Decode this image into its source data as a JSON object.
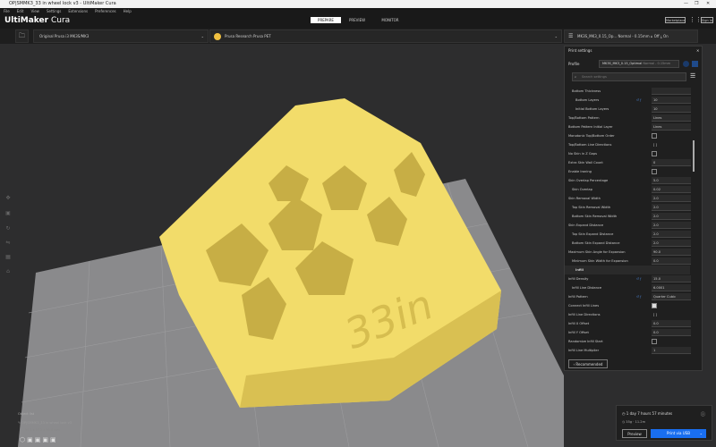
{
  "window": {
    "title": "OP|SMMK3_33 in wheel lock v3 - UltiMaker Cura",
    "controls": [
      "—",
      "❐",
      "✕"
    ]
  },
  "menu": [
    "File",
    "Edit",
    "View",
    "Settings",
    "Extensions",
    "Preferences",
    "Help"
  ],
  "header": {
    "logo_bold": "UltiMaker",
    "logo_light": " Cura",
    "stages": [
      "PREPARE",
      "PREVIEW",
      "MONITOR"
    ],
    "active_stage": "PREPARE",
    "marketplace": "Marketplace",
    "sign_in": "Sign in"
  },
  "toolbar": {
    "printer": "Original Prusa i3 MK3S/MK3",
    "material": "Prusa Research Prusa PET",
    "profile_summary": "MK3S_MK3_0.15_Op... Normal - 0.15mm",
    "support": "Off",
    "adhesion": "On"
  },
  "panel": {
    "title": "Print settings",
    "profile_label": "Profile",
    "profile_value": "MK3S_MK3_0.15_Optimal",
    "profile_sub": "Normal - 0.15mm",
    "search_placeholder": "Search settings",
    "recommended": "Recommended",
    "rows": [
      {
        "label": "Bottom Thickness",
        "indent": 1,
        "type": "value",
        "value": ""
      },
      {
        "label": "Bottom Layers",
        "indent": 2,
        "type": "value",
        "value": "10",
        "icons": true
      },
      {
        "label": "Initial Bottom Layers",
        "indent": 2,
        "type": "value",
        "value": "10"
      },
      {
        "label": "Top/Bottom Pattern",
        "indent": 0,
        "type": "select",
        "value": "Lines"
      },
      {
        "label": "Bottom Pattern Initial Layer",
        "indent": 0,
        "type": "select",
        "value": "Lines"
      },
      {
        "label": "Monotonic Top/Bottom Order",
        "indent": 0,
        "type": "check",
        "checked": false
      },
      {
        "label": "Top/Bottom Line Directions",
        "indent": 0,
        "type": "text",
        "value": "[ ]"
      },
      {
        "label": "No Skin in Z Gaps",
        "indent": 0,
        "type": "check",
        "checked": false
      },
      {
        "label": "Extra Skin Wall Count",
        "indent": 0,
        "type": "value",
        "value": "0"
      },
      {
        "label": "Enable Ironing",
        "indent": 0,
        "type": "check",
        "checked": false
      },
      {
        "label": "Skin Overlap Percentage",
        "indent": 0,
        "type": "value",
        "value": "5.0"
      },
      {
        "label": "Skin Overlap",
        "indent": 1,
        "type": "value",
        "value": "0.02"
      },
      {
        "label": "Skin Removal Width",
        "indent": 0,
        "type": "value",
        "value": "2.0"
      },
      {
        "label": "Top Skin Removal Width",
        "indent": 1,
        "type": "value",
        "value": "2.0"
      },
      {
        "label": "Bottom Skin Removal Width",
        "indent": 1,
        "type": "value",
        "value": "2.0"
      },
      {
        "label": "Skin Expand Distance",
        "indent": 0,
        "type": "value",
        "value": "2.0"
      },
      {
        "label": "Top Skin Expand Distance",
        "indent": 1,
        "type": "value",
        "value": "2.0"
      },
      {
        "label": "Bottom Skin Expand Distance",
        "indent": 1,
        "type": "value",
        "value": "2.0"
      },
      {
        "label": "Maximum Skin Angle for Expansion",
        "indent": 0,
        "type": "value",
        "value": "90.0"
      },
      {
        "label": "Minimum Skin Width for Expansion",
        "indent": 1,
        "type": "value",
        "value": "0.0"
      },
      {
        "label": "Infill",
        "indent": 0,
        "type": "section"
      },
      {
        "label": "Infill Density",
        "indent": 0,
        "type": "value",
        "value": "15.0",
        "icons": true
      },
      {
        "label": "Infill Line Distance",
        "indent": 1,
        "type": "value",
        "value": "6.0001"
      },
      {
        "label": "Infill Pattern",
        "indent": 0,
        "type": "select",
        "value": "Quarter Cubic",
        "icons": true
      },
      {
        "label": "Connect Infill Lines",
        "indent": 0,
        "type": "check",
        "checked": true
      },
      {
        "label": "Infill Line Directions",
        "indent": 0,
        "type": "text",
        "value": "[ ]"
      },
      {
        "label": "Infill X Offset",
        "indent": 0,
        "type": "value",
        "value": "0.0"
      },
      {
        "label": "Infill Y Offset",
        "indent": 0,
        "type": "value",
        "value": "0.0"
      },
      {
        "label": "Randomize Infill Start",
        "indent": 0,
        "type": "check",
        "checked": false
      },
      {
        "label": "Infill Line Multiplier",
        "indent": 0,
        "type": "value",
        "value": "1"
      }
    ]
  },
  "print": {
    "time": "1 day 7 hours 57 minutes",
    "material": "35g · 11.2m",
    "preview": "Preview",
    "print_button": "Print via USB"
  },
  "objects": {
    "header": "Object list",
    "name": "OP|SMMK3_33 in wheel lock v3",
    "dims": "99.2 x 57.2 x 55.0 mm"
  },
  "model": {
    "embossed_text": "33in",
    "color": "#f2dc6a"
  },
  "colors": {
    "accent": "#196ef0",
    "panel": "#1f1f1f",
    "background": "#2d2d2e"
  }
}
